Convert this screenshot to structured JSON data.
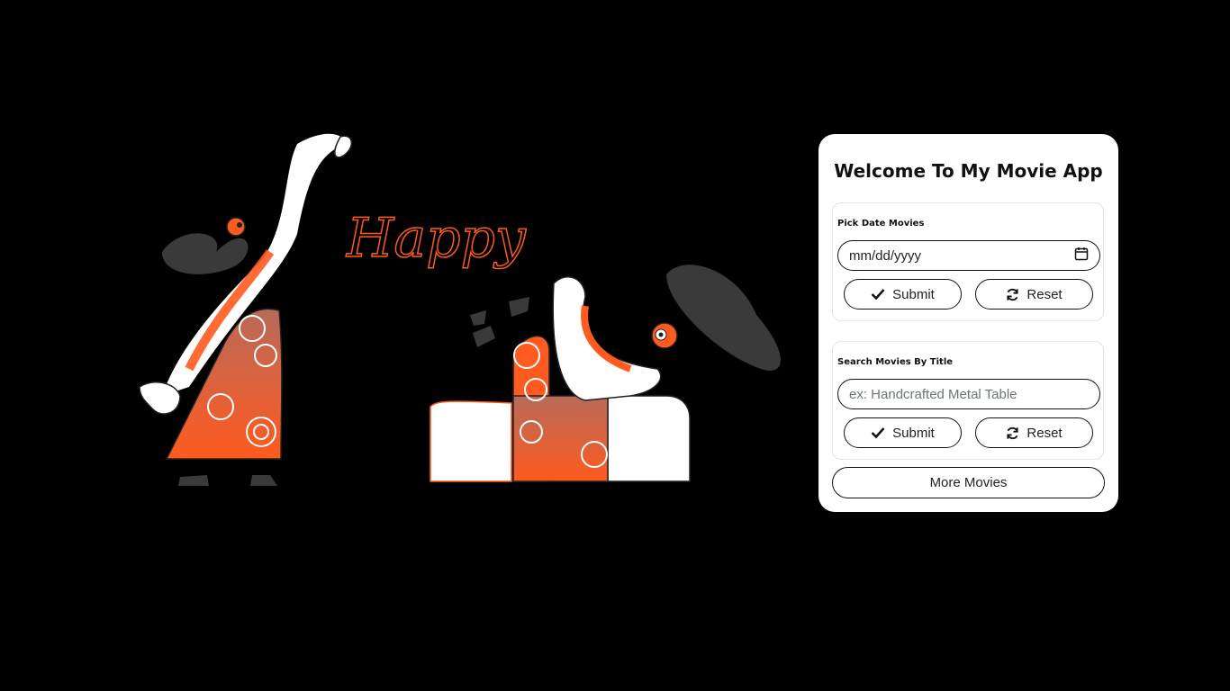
{
  "app": {
    "title": "Welcome To My Movie App"
  },
  "illustration": {
    "script_text": "Happy"
  },
  "date_section": {
    "label": "Pick Date Movies",
    "value": "mm/dd/yyyy",
    "submit_label": "Submit",
    "reset_label": "Reset"
  },
  "title_section": {
    "label": "Search Movies By Title",
    "placeholder": "ex: Handcrafted Metal Table",
    "submit_label": "Submit",
    "reset_label": "Reset"
  },
  "more_label": "More Movies",
  "colors": {
    "background": "#000000",
    "accent": "#ff5a1f",
    "panel": "#ffffff",
    "blob": "#3a3a3a"
  }
}
